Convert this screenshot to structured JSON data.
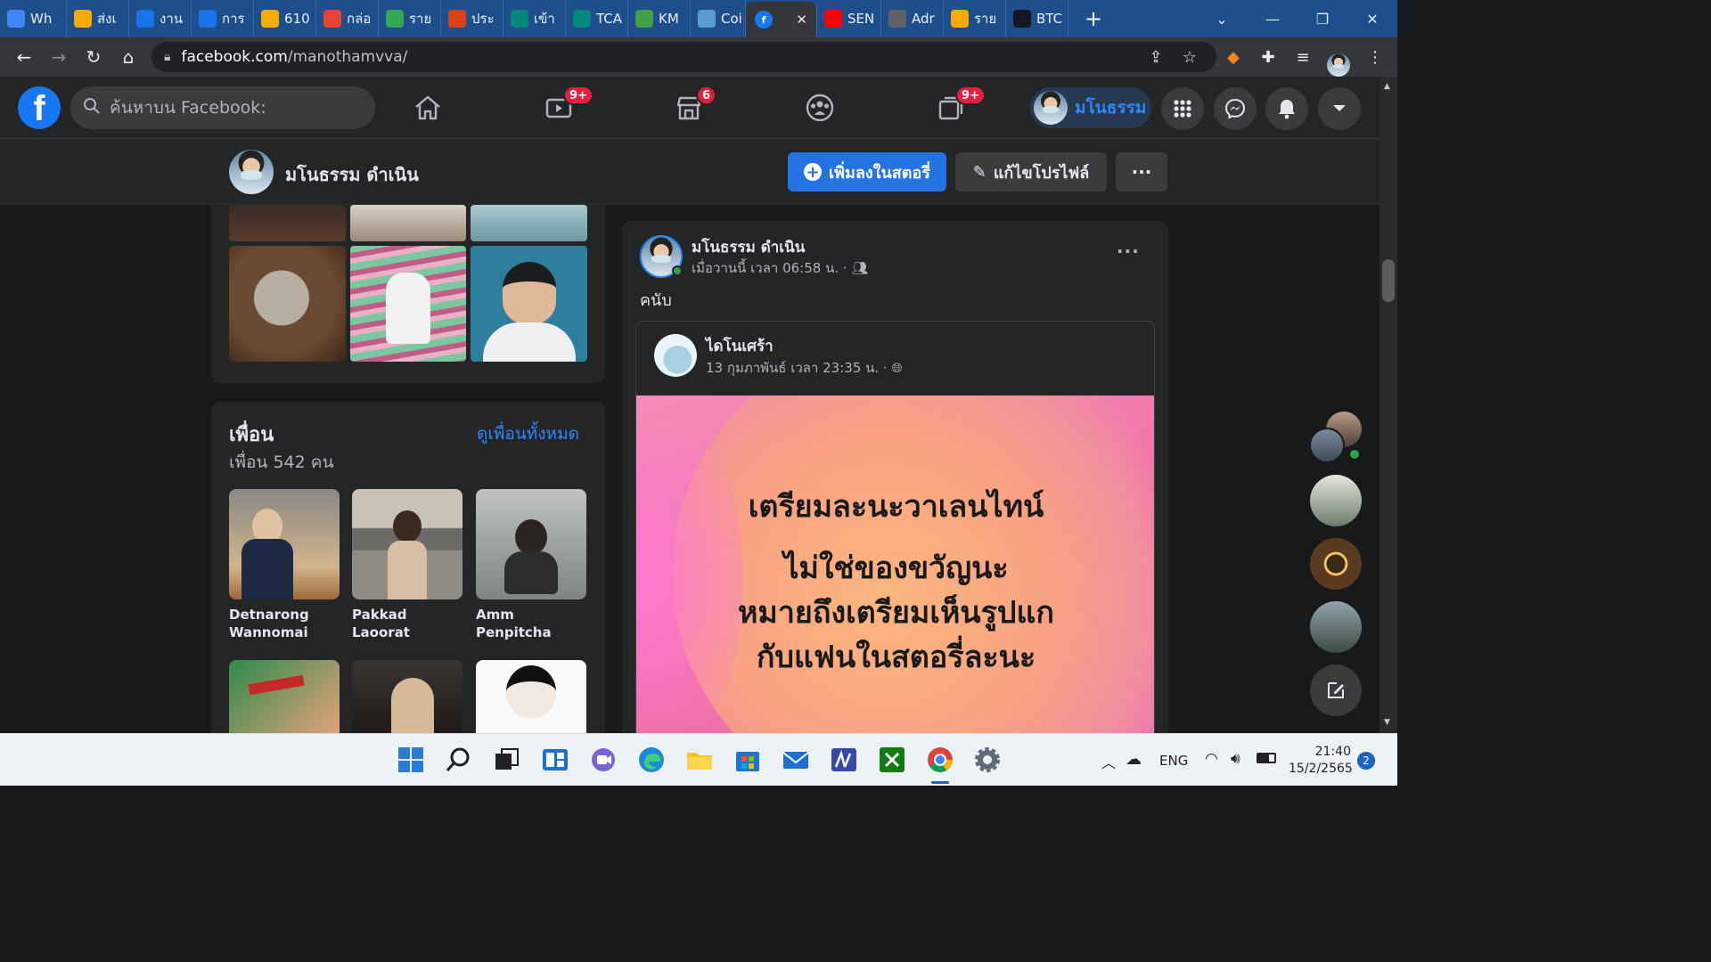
{
  "browser": {
    "tabs": [
      {
        "label": "Wh",
        "icon": "chrome-icon",
        "color": "#4285f4"
      },
      {
        "label": "ส่งเ",
        "icon": "classroom-icon",
        "color": "#f9ab00"
      },
      {
        "label": "งาน",
        "icon": "c-icon",
        "color": "#1a73e8"
      },
      {
        "label": "การ",
        "icon": "c-icon",
        "color": "#1a73e8"
      },
      {
        "label": "610",
        "icon": "classroom-icon",
        "color": "#f9ab00"
      },
      {
        "label": "กล่อ",
        "icon": "gmail-icon",
        "color": "#ea4335"
      },
      {
        "label": "ราย",
        "icon": "drive-icon",
        "color": "#34a853"
      },
      {
        "label": "ประ",
        "icon": "km-icon",
        "color": "#d84315"
      },
      {
        "label": "เข้า",
        "icon": "school-icon",
        "color": "#00897b"
      },
      {
        "label": "TCA",
        "icon": "school-icon",
        "color": "#00897b"
      },
      {
        "label": "KM",
        "icon": "book-icon",
        "color": "#43a047"
      },
      {
        "label": "Coi",
        "icon": "cloud-icon",
        "color": "#5b9bd5"
      },
      {
        "label": "",
        "icon": "facebook-icon",
        "color": "#1877f2",
        "active": true
      },
      {
        "label": "SEN",
        "icon": "youtube-icon",
        "color": "#ff0000"
      },
      {
        "label": "Adr",
        "icon": "globe-icon",
        "color": "#5f6368"
      },
      {
        "label": "ราย",
        "icon": "classroom-icon",
        "color": "#f9ab00"
      },
      {
        "label": "BTC",
        "icon": "tradingview-icon",
        "color": "#131722"
      }
    ],
    "url_domain": "facebook.com",
    "url_path": "/manothamvva/"
  },
  "fb": {
    "search_placeholder": "ค้นหาบน Facebook:",
    "badges": {
      "watch": "9+",
      "marketplace": "6",
      "gaming": "9+"
    },
    "profile_chip_name": "มโนธรรม"
  },
  "profile_bar": {
    "name": "มโนธรรม ดำเนิน",
    "add_story": "เพิ่มลงในสตอรี่",
    "edit_profile": "แก้ไขโปรไฟล์"
  },
  "friends": {
    "title": "เพื่อน",
    "see_all": "ดูเพื่อนทั้งหมด",
    "count": "เพื่อน 542 คน",
    "list": [
      {
        "name": "Detnarong Wannomai"
      },
      {
        "name": "Pakkad Laoorat"
      },
      {
        "name": "Amm Penpitcha"
      }
    ]
  },
  "post": {
    "author": "มโนธรรม ดำเนิน",
    "time": "เมื่อวานนี้ เวลา 06:58 น. · ",
    "text": "คนับ",
    "shared": {
      "author": "ไดโนเศร้า",
      "time": "13 กุมภาพันธ์ เวลา 23:35 น. · ",
      "image_lines": [
        "เตรียมละนะวาเลนไทน์",
        "ไม่ใช่ของขวัญนะ",
        "หมายถึงเตรียมเห็นรูปแก",
        "กับแฟนในสตอรี่ละนะ"
      ]
    }
  },
  "taskbar": {
    "tray_lang": "ENG",
    "time": "21:40",
    "date": "15/2/2565",
    "notifications": "2"
  }
}
